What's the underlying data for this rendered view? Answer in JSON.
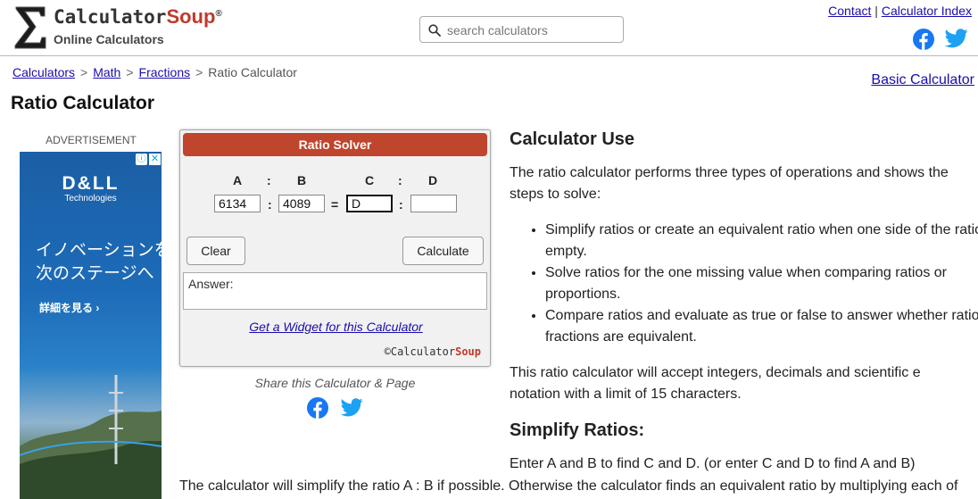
{
  "header": {
    "logo_brand_main": "Calculator",
    "logo_brand_accent": "Soup",
    "logo_registered": "®",
    "logo_sub": "Online Calculators",
    "search": {
      "placeholder": "search calculators"
    },
    "links": {
      "contact": "Contact",
      "separator": "|",
      "calculator_index": "Calculator Index"
    },
    "icons": {
      "sigma": "sigma-logo-icon",
      "facebook": "facebook-icon",
      "twitter": "twitter-icon",
      "search": "search-icon"
    }
  },
  "breadcrumb": {
    "items": [
      "Calculators",
      "Math",
      "Fractions"
    ],
    "current": "Ratio Calculator",
    "separator": ">"
  },
  "basic_calculator_link": "Basic Calculator",
  "page_title": "Ratio Calculator",
  "advertisement": {
    "label": "ADVERTISEMENT",
    "brand": "D&LL",
    "brand_sub": "Technologies",
    "headline": "イノベーションを\n次のステージへ",
    "cta": "詳細を見る ›",
    "info_icon": "ⓘ",
    "close_icon": "✕"
  },
  "calculator": {
    "title": "Ratio Solver",
    "labels": {
      "a": "A",
      "b": "B",
      "c": "C",
      "d": "D",
      "colon": ":",
      "equals": "="
    },
    "inputs": {
      "a": "6134",
      "b": "4089",
      "c": "D",
      "d": ""
    },
    "buttons": {
      "clear": "Clear",
      "calculate": "Calculate"
    },
    "answer_label": "Answer:",
    "widget_link": "Get a Widget for this Calculator",
    "copyright_symbol": "©",
    "copyright_main": "Calculator",
    "copyright_accent": "Soup"
  },
  "share": {
    "label": "Share this Calculator & Page"
  },
  "article": {
    "use_heading": "Calculator Use",
    "intro": "The ratio calculator performs three types of operations and shows the steps to solve:",
    "bullets": [
      "Simplify ratios or create an equivalent ratio when one side of the ratio is empty.",
      "Solve ratios for the one missing value when comparing ratios or proportions.",
      "Compare ratios and evaluate as true or false to answer whether ratios or fractions are equivalent."
    ],
    "limits": "This ratio calculator will accept integers, decimals and scientific e notation with a limit of 15 characters.",
    "simplify_heading": "Simplify Ratios:",
    "simplify_text": "Enter A and B to find C and D. (or enter C and D to find A and B)",
    "bottom_text": "The calculator will simplify the ratio A : B if possible. Otherwise the calculator finds an equivalent ratio by multiplying each of"
  },
  "colors": {
    "accent": "#c0452d",
    "link": "#1a0dab",
    "facebook": "#1877f2",
    "twitter": "#1da1f2"
  }
}
